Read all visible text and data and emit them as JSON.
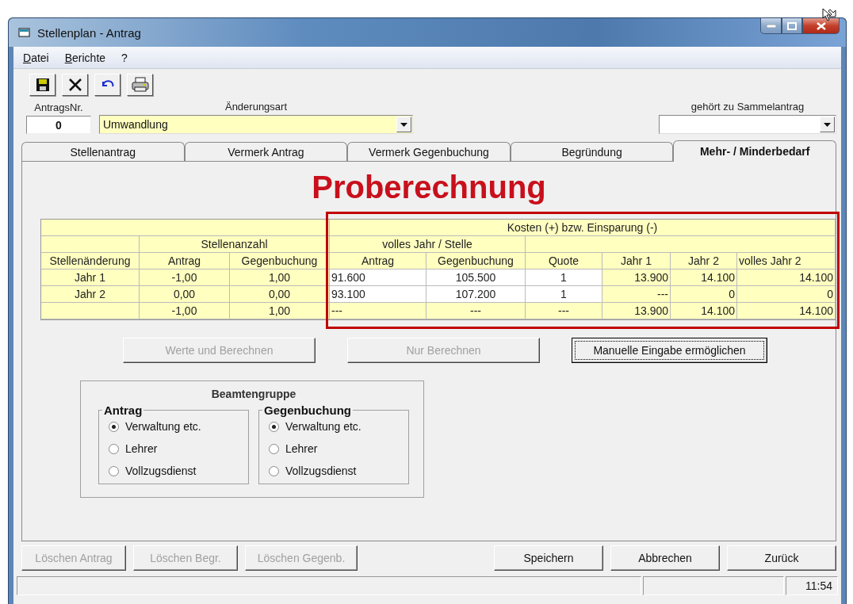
{
  "window": {
    "title": "Stellenplan - Antrag"
  },
  "menu": [
    {
      "label": "Datei"
    },
    {
      "label": "Berichte"
    },
    {
      "label": "?"
    }
  ],
  "toolbar": [
    {
      "kind": "save"
    },
    {
      "kind": "delete"
    },
    {
      "kind": "undo"
    },
    {
      "kind": "print"
    }
  ],
  "fields": {
    "antrags_nr": {
      "label": "AntragsNr.",
      "value": "0"
    },
    "aenderungsart": {
      "label": "Änderungsart",
      "value": "Umwandlung"
    },
    "sammelantrag": {
      "label": "gehört zu Sammelantrag"
    }
  },
  "tabs": [
    {
      "label": "Stellenantrag",
      "selected": false
    },
    {
      "label": "Vermerk Antrag",
      "selected": false
    },
    {
      "label": "Vermerk Gegenbuchung",
      "selected": false
    },
    {
      "label": "Begründung",
      "selected": false
    },
    {
      "label": "Mehr- / Minderbedarf",
      "selected": true
    }
  ],
  "heading": "Proberechnung",
  "table": {
    "costs_highlighted": true,
    "group_headers": {
      "costs": "Kosten (+) bzw. Einsparung (-)",
      "positions": "Stellenanzahl",
      "per_position": "volles Jahr / Stelle"
    },
    "columns": [
      "Stellenänderung",
      "Antrag",
      "Gegenbuchung",
      "Antrag",
      "Gegenbuchung",
      "Quote",
      "Jahr 1",
      "Jahr 2",
      "volles Jahr 2"
    ],
    "rows": [
      {
        "cells": [
          {
            "text": "Jahr 1",
            "editable": false
          },
          {
            "text": "-1,00",
            "editable": false
          },
          {
            "text": "1,00",
            "editable": false
          },
          {
            "text": "91.600",
            "editable": true
          },
          {
            "text": "105.500",
            "editable": true
          },
          {
            "text": "1",
            "editable": true
          },
          {
            "text": "13.900",
            "editable": false
          },
          {
            "text": "14.100",
            "editable": false
          },
          {
            "text": "14.100",
            "editable": false
          }
        ]
      },
      {
        "cells": [
          {
            "text": "Jahr 2",
            "editable": false
          },
          {
            "text": "0,00",
            "editable": false
          },
          {
            "text": "0,00",
            "editable": false
          },
          {
            "text": "93.100",
            "editable": true
          },
          {
            "text": "107.200",
            "editable": true
          },
          {
            "text": "1",
            "editable": true
          },
          {
            "text": "---",
            "editable": false
          },
          {
            "text": "0",
            "editable": false
          },
          {
            "text": "0",
            "editable": false
          }
        ]
      },
      {
        "cells": [
          {
            "editable": false
          },
          {
            "text": "-1,00",
            "editable": false
          },
          {
            "text": "1,00",
            "editable": false
          },
          {
            "text": "---",
            "editable": false
          },
          {
            "text": "---",
            "editable": false
          },
          {
            "text": "---",
            "editable": false
          },
          {
            "text": "13.900",
            "editable": false
          },
          {
            "text": "14.100",
            "editable": false
          },
          {
            "text": "14.100",
            "editable": false
          }
        ]
      }
    ]
  },
  "actions": [
    {
      "label": "Werte und Berechnen",
      "disabled": true,
      "focused": false
    },
    {
      "label": "Nur Berechnen",
      "disabled": true,
      "focused": false
    },
    {
      "label": "Manuelle Eingabe ermöglichen",
      "disabled": false,
      "focused": true
    }
  ],
  "beamtengruppe": {
    "title": "Beamtengruppe",
    "groups": [
      {
        "title": "Antrag",
        "options": [
          {
            "label": "Verwaltung etc.",
            "selected": true
          },
          {
            "label": "Lehrer",
            "selected": false
          },
          {
            "label": "Vollzugsdienst",
            "selected": false
          }
        ]
      },
      {
        "title": "Gegenbuchung",
        "options": [
          {
            "label": "Verwaltung etc.",
            "selected": true
          },
          {
            "label": "Lehrer",
            "selected": false
          },
          {
            "label": "Vollzugsdienst",
            "selected": false
          }
        ]
      }
    ]
  },
  "footer_buttons": [
    {
      "label": "Löschen Antrag",
      "disabled": true
    },
    {
      "label": "Löschen Begr.",
      "disabled": true
    },
    {
      "label": "Löschen Gegenb.",
      "disabled": true
    },
    {
      "label": "Speichern",
      "disabled": false
    },
    {
      "label": "Abbrechen",
      "disabled": false
    },
    {
      "label": "Zurück",
      "disabled": false
    }
  ],
  "status_bar": {
    "time": "11:54"
  }
}
